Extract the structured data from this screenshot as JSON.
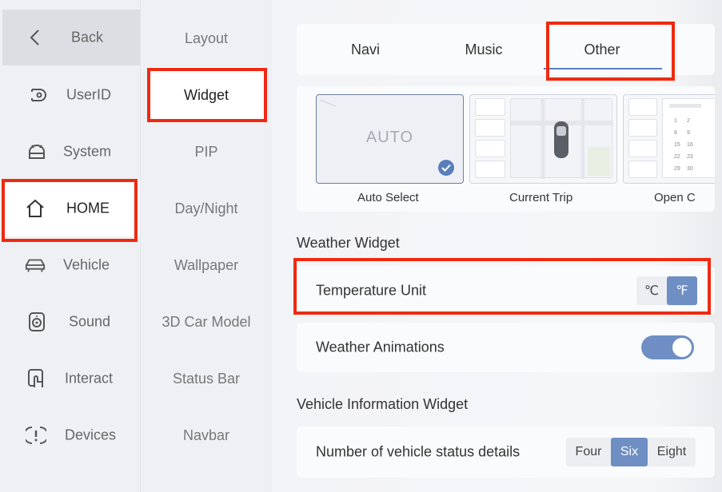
{
  "nav": {
    "back": "Back",
    "items": [
      {
        "label": "UserID",
        "icon": "user-id-icon"
      },
      {
        "label": "System",
        "icon": "android-icon"
      },
      {
        "label": "HOME",
        "icon": "home-icon"
      },
      {
        "label": "Vehicle",
        "icon": "car-icon"
      },
      {
        "label": "Sound",
        "icon": "speaker-icon"
      },
      {
        "label": "Interact",
        "icon": "touch-icon"
      },
      {
        "label": "Devices",
        "icon": "devices-icon"
      }
    ]
  },
  "subnav": {
    "items": [
      "Layout",
      "Widget",
      "PIP",
      "Day/Night",
      "Wallpaper",
      "3D Car Model",
      "Status Bar",
      "Navbar"
    ]
  },
  "tabs": [
    "Navi",
    "Music",
    "Other"
  ],
  "widgets": {
    "auto_text": "AUTO",
    "captions": [
      "Auto Select",
      "Current Trip",
      "Open C"
    ],
    "calendar_numbers": [
      "1",
      "2",
      "8",
      "9",
      "15",
      "16",
      "22",
      "23",
      "29",
      "30"
    ]
  },
  "weather": {
    "title": "Weather Widget",
    "temp_label": "Temperature Unit",
    "celsius": "℃",
    "fahrenheit": "℉",
    "selected_unit": "℉",
    "animations_label": "Weather Animations",
    "animations_on": true
  },
  "vehicle_info": {
    "title": "Vehicle Information Widget",
    "details_label": "Number of vehicle status details",
    "options": [
      "Four",
      "Six",
      "Eight"
    ],
    "selected": "Six"
  },
  "colors": {
    "accent": "#6f8fc4",
    "highlight": "#ee2a11"
  }
}
